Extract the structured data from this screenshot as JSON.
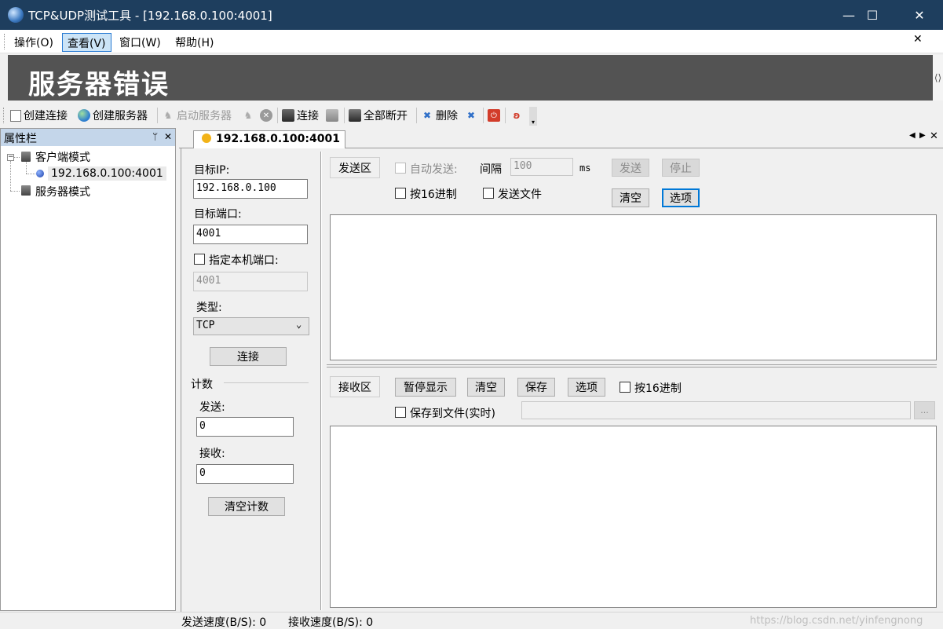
{
  "window": {
    "title": "TCP&UDP测试工具 - [192.168.0.100:4001]",
    "minimize": "—",
    "maximize": "☐",
    "close": "✕"
  },
  "menu": [
    "操作(O)",
    "查看(V)",
    "窗口(W)",
    "帮助(H)"
  ],
  "mdi_close": "✕",
  "banner": {
    "text": "服务器错误"
  },
  "toolbar": {
    "create_connection": "创建连接",
    "create_server": "创建服务器",
    "start_server": "启动服务器",
    "connect": "连接",
    "disconnect_all": "全部断开",
    "delete": "删除"
  },
  "property_panel": {
    "title": "属性栏",
    "pin": "ᛘ",
    "close": "✕",
    "tree": {
      "client_mode": "客户端模式",
      "client_item": "192.168.0.100:4001",
      "server_mode": "服务器模式"
    }
  },
  "tab": {
    "label": "192.168.0.100:4001"
  },
  "connection": {
    "target_ip_label": "目标IP:",
    "target_ip": "192.168.0.100",
    "target_port_label": "目标端口:",
    "target_port": "4001",
    "local_port_label": "指定本机端口:",
    "local_port": "4001",
    "type_label": "类型:",
    "type_value": "TCP",
    "connect_button": "连接",
    "count_label": "计数",
    "send_label": "发送:",
    "send_count": "0",
    "recv_label": "接收:",
    "recv_count": "0",
    "clear_count_button": "清空计数"
  },
  "send_area": {
    "label": "发送区",
    "auto_send": "自动发送:",
    "interval_label": "间隔",
    "interval_value": "100",
    "unit": "ms",
    "send_button": "发送",
    "stop_button": "停止",
    "hex_label": "按16进制",
    "send_file_label": "发送文件",
    "clear_button": "清空",
    "options_button": "选项"
  },
  "recv_area": {
    "label": "接收区",
    "pause_button": "暂停显示",
    "clear_button": "清空",
    "save_button": "保存",
    "options_button": "选项",
    "hex_label": "按16进制",
    "save_to_file_label": "保存到文件(实时)",
    "browse_button": "..."
  },
  "status": {
    "send_speed": "发送速度(B/S): 0",
    "recv_speed": "接收速度(B/S): 0"
  },
  "watermark": "https://blog.csdn.net/yinfengnong"
}
